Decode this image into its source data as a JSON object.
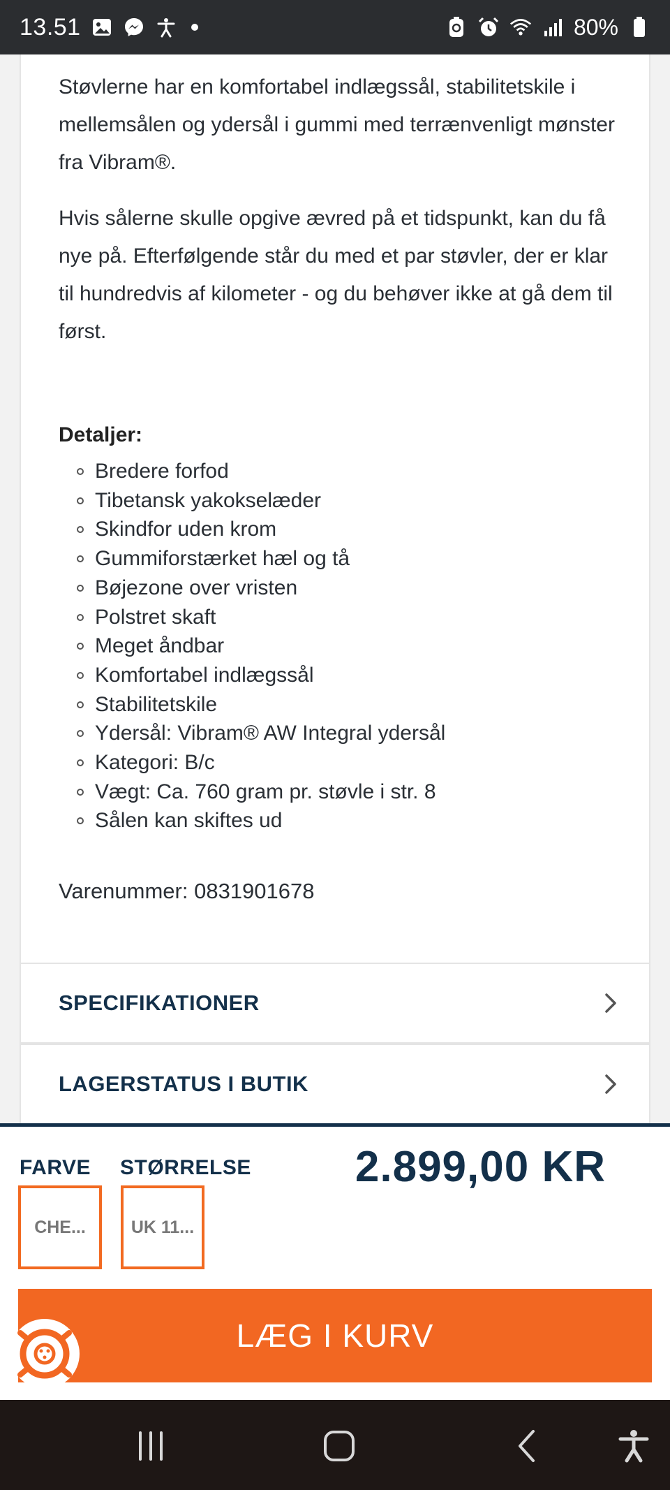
{
  "status_bar": {
    "time": "13.51",
    "battery": "80%",
    "left_icons": [
      "gallery-icon",
      "messenger-icon",
      "accessibility-icon"
    ],
    "right_icons": [
      "battery-saver-icon",
      "alarm-icon",
      "wifi-icon",
      "signal-icon",
      "battery-icon"
    ]
  },
  "description": {
    "paragraph1": "Støvlerne har en komfortabel indlægssål, stabilitetskile i mellemsålen og ydersål i gummi med terrænvenligt mønster fra Vibram®.",
    "paragraph2": "Hvis sålerne skulle opgive ævred på et tidspunkt, kan du få nye på. Efterfølgende står du med et par støvler, der er klar til hundredvis af kilometer - og du behøver ikke at gå dem til først."
  },
  "details": {
    "title": "Detaljer:",
    "items": [
      "Bredere forfod",
      "Tibetansk yakokselæder",
      "Skindfor uden krom",
      "Gummiforstærket hæl og tå",
      "Bøjezone over vristen",
      "Polstret skaft",
      "Meget åndbar",
      "Komfortabel indlægssål",
      "Stabilitetskile",
      "Ydersål: Vibram® AW Integral ydersål",
      "Kategori: B/c",
      "Vægt: Ca. 760 gram pr. støvle i str. 8",
      "Sålen kan skiftes ud"
    ]
  },
  "sku": "Varenummer: 0831901678",
  "accordions": {
    "specs": "SPECIFIKATIONER",
    "stock": "LAGERSTATUS I BUTIK"
  },
  "buy_bar": {
    "color_label": "FARVE",
    "color_value": "CHE...",
    "size_label": "STØRRELSE",
    "size_value": "UK 11...",
    "price": "2.899,00 KR",
    "cart_button": "LÆG I KURV"
  },
  "colors": {
    "accent": "#f26722",
    "navy": "#13304a",
    "statusbar": "#2b2d30",
    "navbar": "#1e1715"
  }
}
